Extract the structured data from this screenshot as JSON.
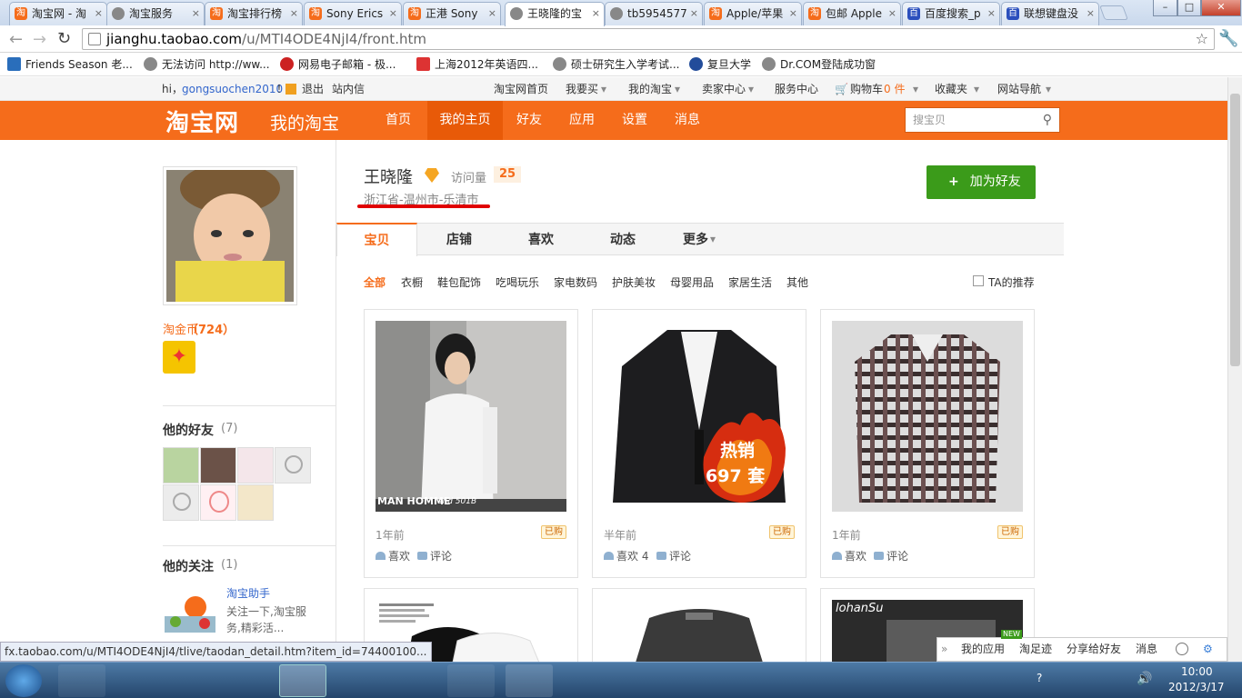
{
  "browser": {
    "tabs": [
      {
        "title": "淘宝网 - 淘",
        "icon": "taobao-icon"
      },
      {
        "title": "淘宝服务",
        "icon": "globe-icon"
      },
      {
        "title": "淘宝排行榜",
        "icon": "taobao-icon"
      },
      {
        "title": "Sony Erics",
        "icon": "taobao-icon"
      },
      {
        "title": "正港 Sony",
        "icon": "taobao-icon"
      },
      {
        "title": "王晓隆的宝",
        "icon": "globe-icon"
      },
      {
        "title": "tb5954577",
        "icon": "globe-icon"
      },
      {
        "title": "Apple/苹果",
        "icon": "taobao-icon"
      },
      {
        "title": "包邮 Apple",
        "icon": "taobao-icon"
      },
      {
        "title": "百度搜索_p",
        "icon": "baidu-icon"
      },
      {
        "title": "联想键盘没",
        "icon": "baidu-icon"
      }
    ],
    "active_tab": 5,
    "url_host": "jianghu.taobao.com",
    "url_path": "/u/MTI4ODE4NjI4/front.htm",
    "bookmarks": [
      "Friends Season 老...",
      "无法访问 http://ww...",
      "网易电子邮箱 - 极...",
      "上海2012年英语四...",
      "硕士研究生入学考试...",
      "复旦大学",
      "Dr.COM登陆成功窗"
    ]
  },
  "site_nav": {
    "greeting": "hi，",
    "username": "gongsuochen2010",
    "excl": "！",
    "logout": "退出",
    "messages": "站内信",
    "links": [
      "淘宝网首页",
      "我要买",
      "我的淘宝",
      "卖家中心",
      "服务中心",
      "购物车",
      "收藏夹",
      "网站导航"
    ],
    "cart_count": "0 件"
  },
  "header": {
    "logo": "淘宝网",
    "subtitle": "我的淘宝",
    "nav": [
      "首页",
      "我的主页",
      "好友",
      "应用",
      "设置",
      "消息"
    ],
    "active_nav": 1,
    "search_placeholder": "搜宝贝"
  },
  "profile": {
    "name": "王晓隆",
    "visits_label": "访问量",
    "visits": "25",
    "location": "浙江省-温州市-乐清市",
    "add_friend": "加为好友",
    "coin_label": "淘金币",
    "coin_value": "（724）"
  },
  "friends": {
    "title": "他的好友",
    "count": "(7)"
  },
  "following": {
    "title": "他的关注",
    "count": "(1)",
    "item_name": "淘宝助手",
    "item_desc": "关注一下,淘宝服务,精彩活..."
  },
  "subtabs": [
    "宝贝",
    "店铺",
    "喜欢",
    "动态",
    "更多"
  ],
  "categories": [
    "全部",
    "衣橱",
    "鞋包配饰",
    "吃喝玩乐",
    "家电数码",
    "护肤美妆",
    "母婴用品",
    "家居生活",
    "其他"
  ],
  "ta_recommend": "TA的推荐",
  "items": [
    {
      "time": "1年前",
      "bought": "已购",
      "like": "喜欢",
      "comment": "评论",
      "caption": "MAN HOMME",
      "caption2": "and 501B"
    },
    {
      "time": "半年前",
      "bought": "已购",
      "like": "喜欢 4",
      "comment": "评论",
      "hot1": "热销",
      "hot2": "697 套"
    },
    {
      "time": "1年前",
      "bought": "已购",
      "like": "喜欢",
      "comment": "评论"
    }
  ],
  "row2_captions": {
    "brand": "lohanSu"
  },
  "status_url": "fx.taobao.com/u/MTI4ODE4NjI4/tlive/taodan_detail.htm?item_id=74400100...",
  "bottom_bar": {
    "apps": "我的应用",
    "footprints": "淘足迹",
    "share": "分享给好友",
    "msg": "消息",
    "new_badge": "NEW"
  },
  "taskbar": {
    "time": "10:00",
    "date": "2012/3/17"
  },
  "colors": {
    "taobao_orange": "#f56c1b",
    "link_blue": "#36c",
    "add_green": "#3b9b1a"
  }
}
